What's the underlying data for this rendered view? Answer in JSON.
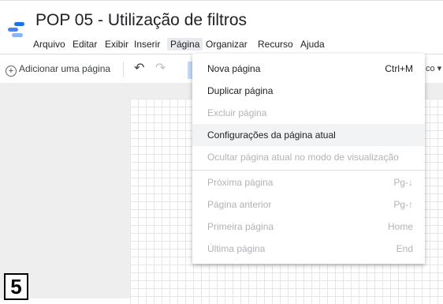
{
  "app": {
    "title": "POP 05 - Utilização de filtros",
    "menus": [
      "Arquivo",
      "Editar",
      "Exibir",
      "Inserir",
      "Página",
      "Organizar",
      "Recurso",
      "Ajuda"
    ]
  },
  "toolbar": {
    "add_page_label": "Adicionar uma página",
    "theme_label": "co ▾"
  },
  "page_menu": {
    "items": [
      {
        "label": "Nova página",
        "shortcut": "Ctrl+M"
      },
      {
        "label": "Duplicar página",
        "shortcut": ""
      },
      {
        "label": "Excluir página",
        "shortcut": ""
      },
      {
        "label": "Configurações da página atual",
        "shortcut": ""
      },
      {
        "label": "Ocultar página atual no modo de visualização",
        "shortcut": ""
      },
      {
        "label": "Próxima página",
        "shortcut": "Pg-↓"
      },
      {
        "label": "Página anterior",
        "shortcut": "Pg-↑"
      },
      {
        "label": "Primeira página",
        "shortcut": "Home"
      },
      {
        "label": "Última página",
        "shortcut": "End"
      }
    ]
  },
  "overlay": {
    "marker": "5"
  },
  "colors": {
    "accent": "#4285f4",
    "highlight": "#f1f3f4",
    "disabled_text": "#b0b3b7"
  }
}
